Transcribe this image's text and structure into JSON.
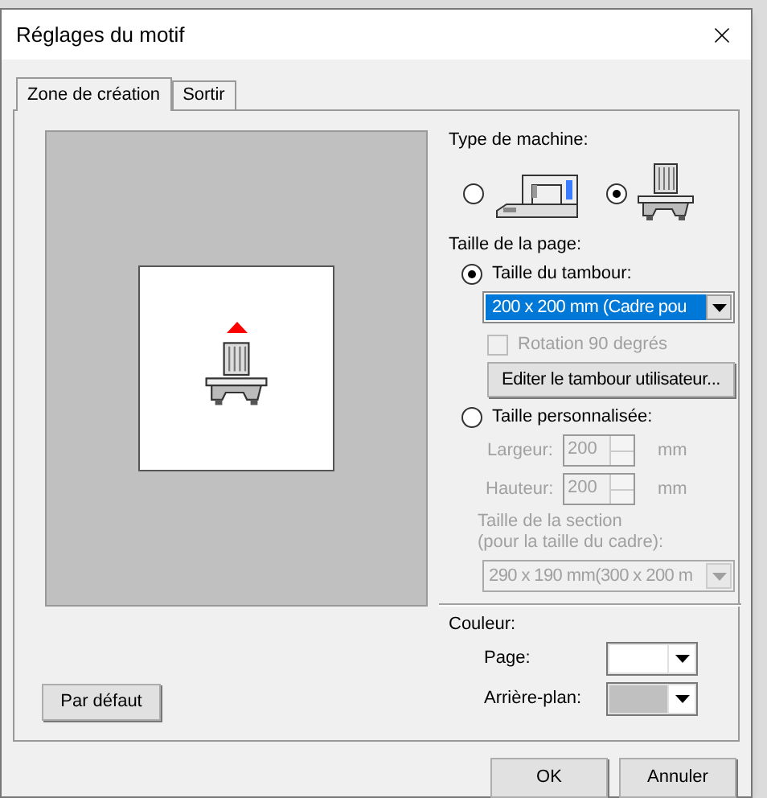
{
  "window": {
    "title": "Réglages du motif"
  },
  "tabs": [
    {
      "label": "Zone de création",
      "selected": true
    },
    {
      "label": "Sortir",
      "selected": false
    }
  ],
  "machine_type": {
    "label": "Type de machine:",
    "options": [
      {
        "kind": "single-needle",
        "selected": false
      },
      {
        "kind": "multi-needle",
        "selected": true
      }
    ]
  },
  "page_size": {
    "label": "Taille de la page:",
    "hoop": {
      "label": "Taille du tambour:",
      "selected": true,
      "value": "200 x 200 mm (Cadre pou",
      "rotation": {
        "label": "Rotation 90 degrés",
        "checked": false
      },
      "edit_button": "Editer le tambour utilisateur..."
    },
    "custom": {
      "label": "Taille personnalisée:",
      "selected": false,
      "fields": [
        {
          "label": "Largeur:",
          "value": "200",
          "unit": "mm"
        },
        {
          "label": "Hauteur:",
          "value": "200",
          "unit": "mm"
        }
      ],
      "section_label": [
        "Taille de la section",
        "(pour la taille du cadre):"
      ],
      "section_value": "290 x 190 mm(300 x 200 m"
    }
  },
  "color": {
    "label": "Couleur:",
    "items": [
      {
        "label": "Page:",
        "color": "#ffffff"
      },
      {
        "label": "Arrière-plan:",
        "color": "#c0c0c0"
      }
    ]
  },
  "default_button": "Par défaut",
  "buttons": [
    "OK",
    "Annuler"
  ]
}
